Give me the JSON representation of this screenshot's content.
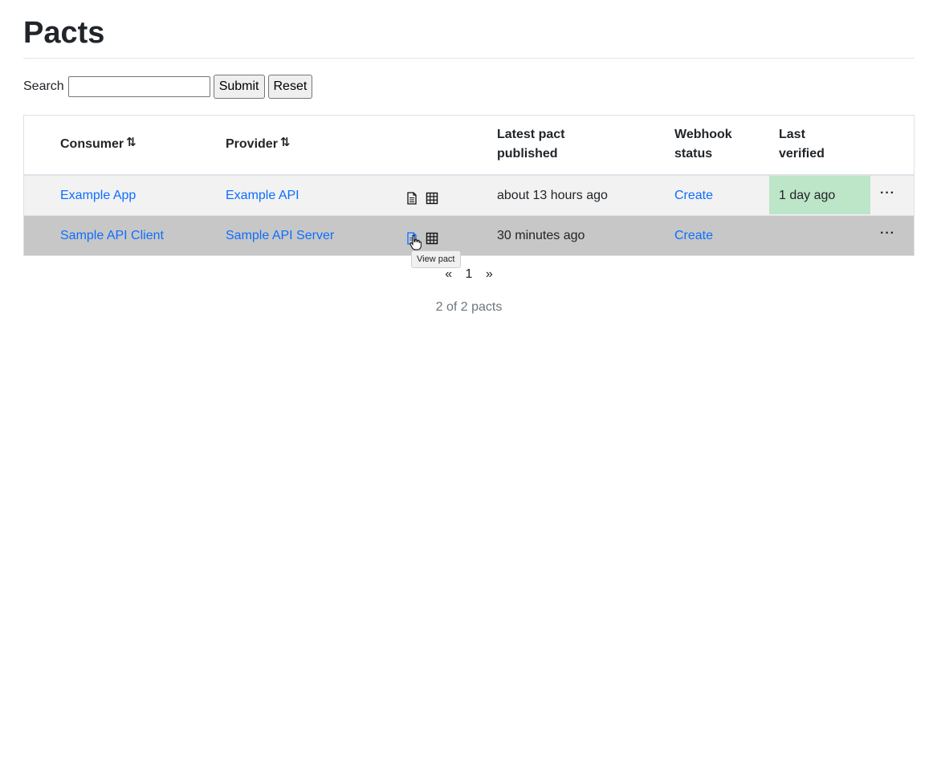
{
  "page": {
    "title": "Pacts"
  },
  "search": {
    "label": "Search",
    "value": "",
    "submit_label": "Submit",
    "reset_label": "Reset"
  },
  "table": {
    "headers": {
      "consumer": "Consumer",
      "provider": "Provider",
      "latest_pact_line1": "Latest pact",
      "latest_pact_line2": "published",
      "webhook_line1": "Webhook",
      "webhook_line2": "status",
      "last_verified_line1": "Last",
      "last_verified_line2": "verified",
      "sort_glyph": "⇅"
    },
    "rows": [
      {
        "consumer": "Example App",
        "provider": "Example API",
        "published": "about 13 hours ago",
        "webhook": "Create",
        "last_verified": "1 day ago",
        "actions": "···"
      },
      {
        "consumer": "Sample API Client",
        "provider": "Sample API Server",
        "published": "30 minutes ago",
        "webhook": "Create",
        "last_verified": "",
        "actions": "···"
      }
    ]
  },
  "tooltip": {
    "text": "View pact"
  },
  "pagination": {
    "prev": "«",
    "page": "1",
    "next": "»"
  },
  "summary": {
    "count_text": "2 of 2 pacts"
  },
  "colors": {
    "link": "#0d6efd",
    "verified_bg": "#bde5c8",
    "row_hover": "#c7c7c7"
  }
}
